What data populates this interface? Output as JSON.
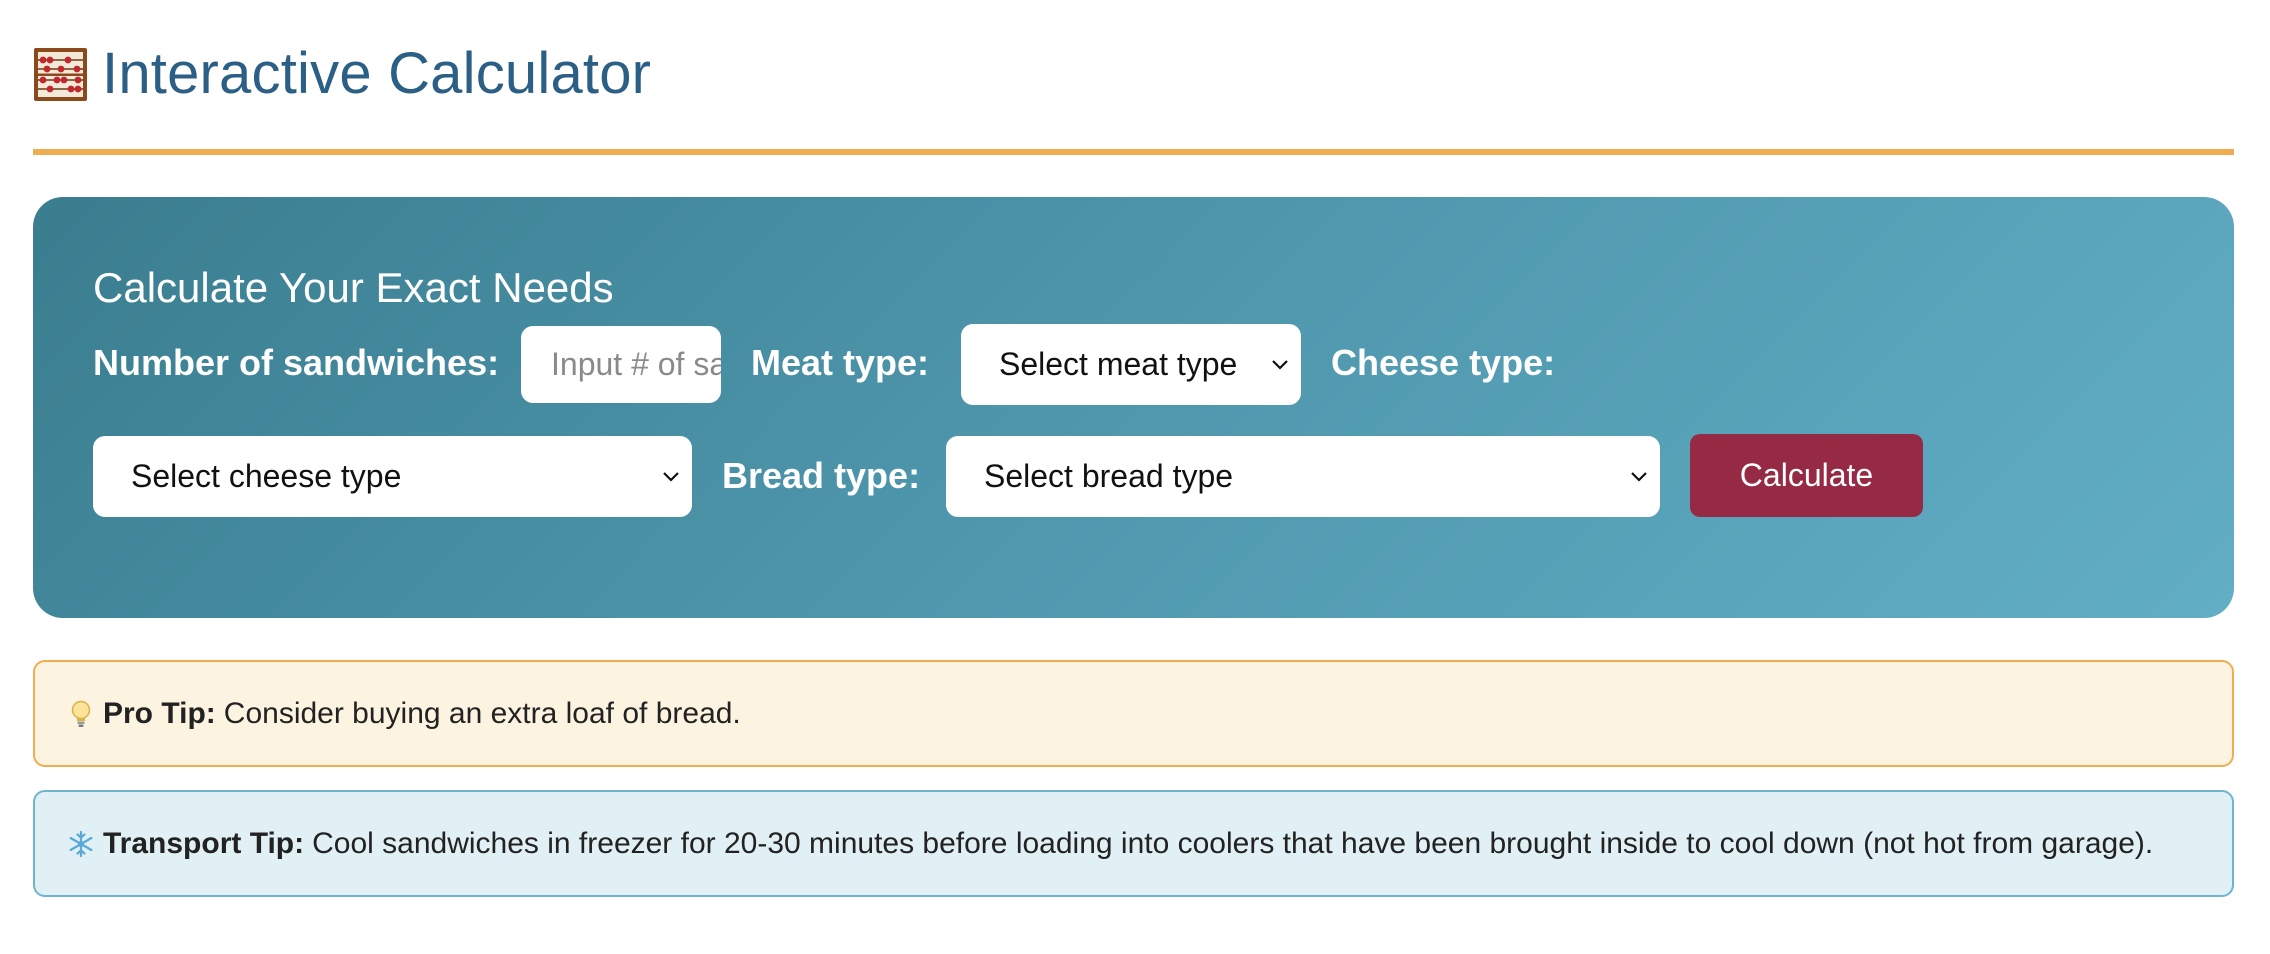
{
  "header": {
    "title": "Interactive Calculator",
    "icon": "abacus-icon"
  },
  "calculator": {
    "heading": "Calculate Your Exact Needs",
    "sandwiches": {
      "label": "Number of sandwiches:",
      "placeholder": "Input # of sandwiches",
      "value": ""
    },
    "meat": {
      "label": "Meat type:",
      "selected": "Select meat type"
    },
    "cheese": {
      "label": "Cheese type:",
      "selected": "Select cheese type"
    },
    "bread": {
      "label": "Bread type:",
      "selected": "Select bread type"
    },
    "calculate_label": "Calculate"
  },
  "tips": {
    "pro": {
      "icon": "lightbulb-icon",
      "label": "Pro Tip:",
      "text": "Consider buying an extra loaf of bread."
    },
    "transport": {
      "icon": "snowflake-icon",
      "label": "Transport Tip:",
      "text": "Cool sandwiches in freezer for 20-30 minutes before loading into coolers that have been brought inside to cool down (not hot from garage)."
    }
  },
  "colors": {
    "title": "#2c5f85",
    "divider": "#f0ad4e",
    "panel_start": "#3a7d8f",
    "panel_end": "#62aec5",
    "button": "#962a44",
    "pro_tip_bg": "#fdf3e1",
    "transport_tip_bg": "#e0f0f4"
  }
}
